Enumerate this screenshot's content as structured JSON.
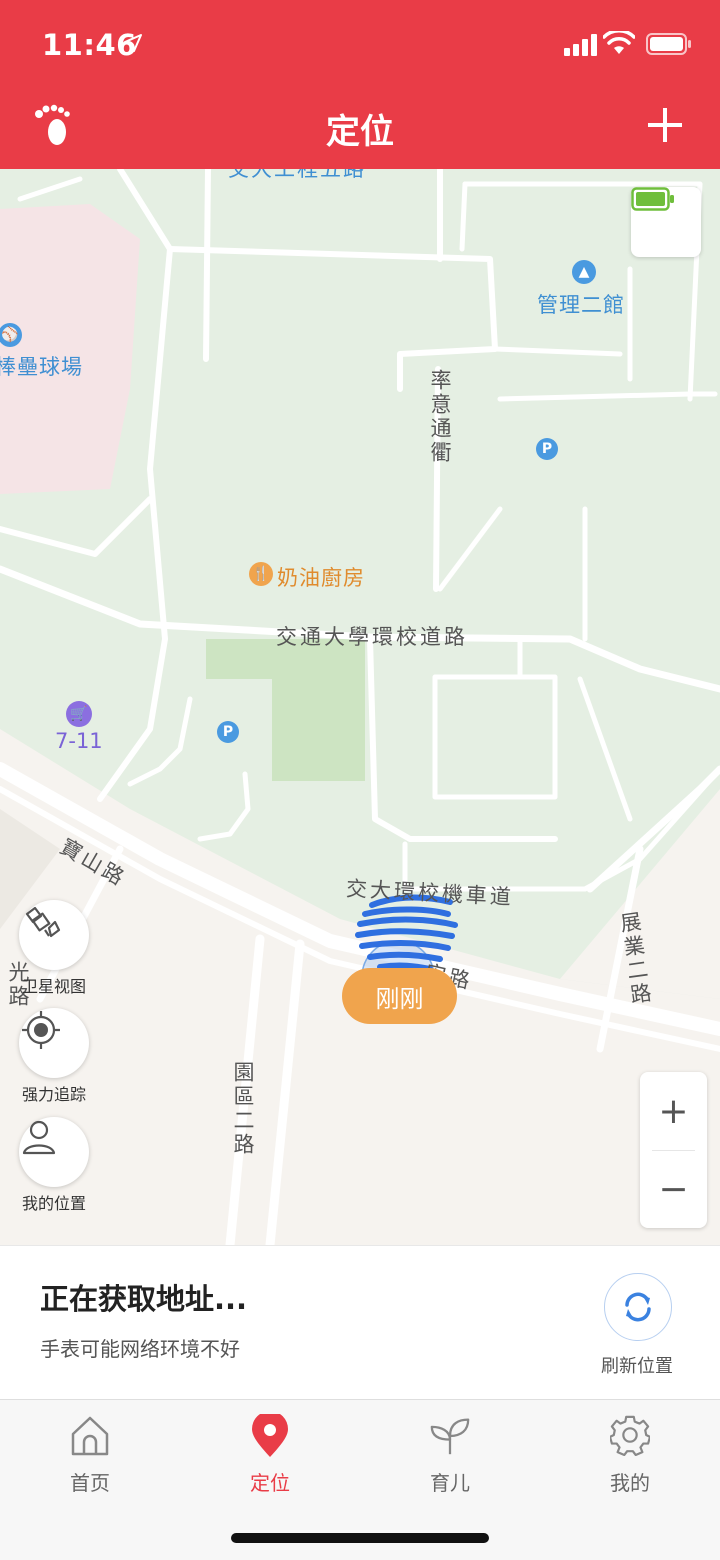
{
  "status_bar": {
    "time": "11:46"
  },
  "nav": {
    "title": "定位",
    "left_icon": "footprint-icon",
    "right_icon": "plus-icon"
  },
  "map": {
    "labels": {
      "top_road": "交大工程五路",
      "management": "管理二館",
      "baseball": "棒壘球場",
      "lv_yi": "率意通衢",
      "restaurant": "奶油廚房",
      "campus_road": "交通大學環校道路",
      "seven_eleven": "7-11",
      "baoshan": "寶山路",
      "moto_road": "交大環校機車道",
      "an_road": "安路",
      "zhanye": "展業二路",
      "yuanqu": "園區二路",
      "left_road": "光路"
    },
    "time_badge": "刚刚",
    "colors": {
      "primary": "#e93c47",
      "map_green": "#e5efe3",
      "pill": "#f0a44d"
    }
  },
  "side_buttons": {
    "satellite": "卫星视图",
    "tracking": "强力追踪",
    "my_location": "我的位置"
  },
  "zoom": {
    "in": "+",
    "out": "−"
  },
  "address": {
    "title": "正在获取地址...",
    "subtitle": "手表可能网络环境不好",
    "refresh": "刷新位置"
  },
  "tabs": [
    {
      "label": "首页",
      "icon": "home-icon"
    },
    {
      "label": "定位",
      "icon": "location-pin-icon",
      "active": true
    },
    {
      "label": "育儿",
      "icon": "sprout-icon"
    },
    {
      "label": "我的",
      "icon": "gear-icon"
    }
  ]
}
